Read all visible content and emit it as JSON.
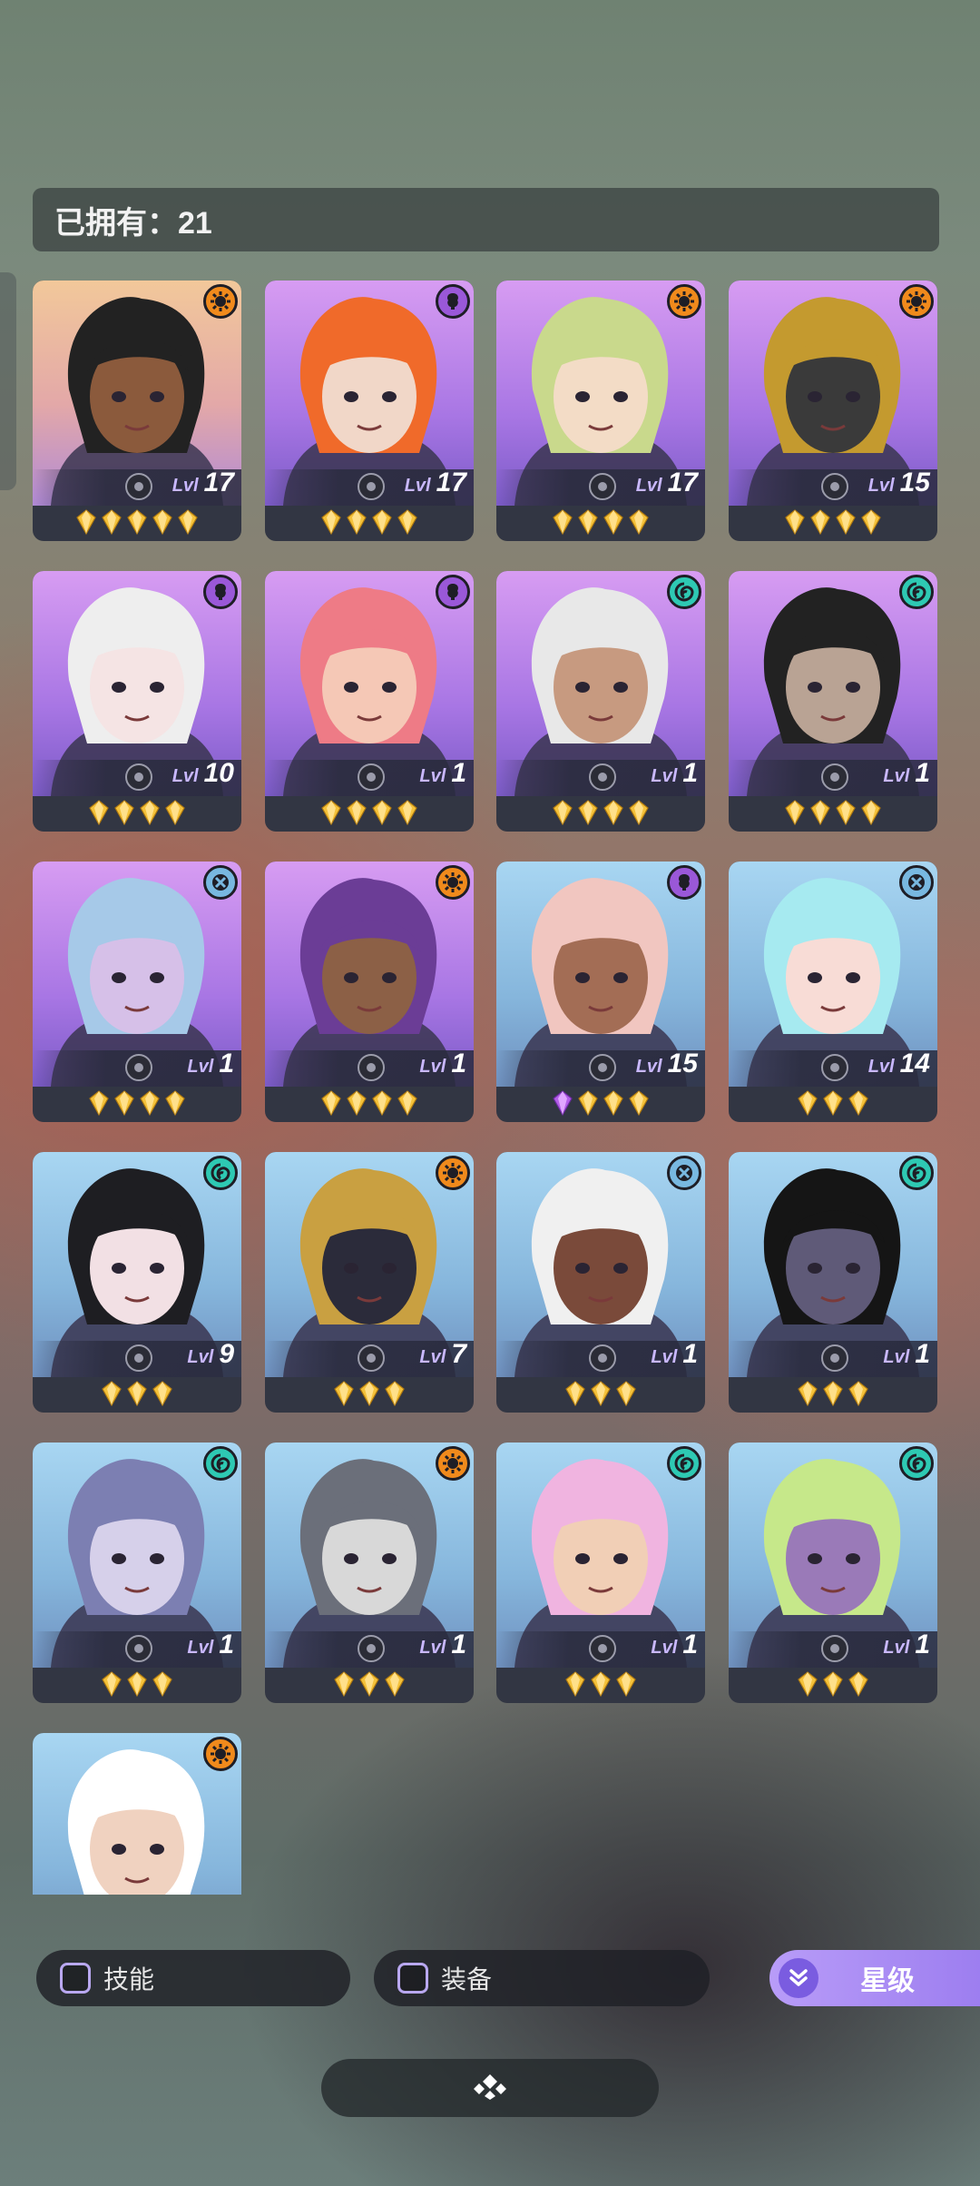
{
  "owned": {
    "label": "已拥有：21"
  },
  "level_prefix": "Lvl",
  "heroes": [
    {
      "element": "fire",
      "bg": "orange",
      "level": "17",
      "stars": 5,
      "skin": "#8b5a3c",
      "hair": "#222222"
    },
    {
      "element": "mind",
      "bg": "purple",
      "level": "17",
      "stars": 4,
      "skin": "#f1d7c8",
      "hair": "#f06a2a"
    },
    {
      "element": "fire",
      "bg": "purple",
      "level": "17",
      "stars": 4,
      "skin": "#f3dcc6",
      "hair": "#c9d98c"
    },
    {
      "element": "fire",
      "bg": "purple",
      "level": "15",
      "stars": 4,
      "skin": "#3a3a3a",
      "hair": "#c49a2f"
    },
    {
      "element": "mind",
      "bg": "purple",
      "level": "10",
      "stars": 4,
      "skin": "#f5e4e4",
      "hair": "#eeeeee"
    },
    {
      "element": "mind",
      "bg": "purple",
      "level": "1",
      "stars": 4,
      "skin": "#f5c8b6",
      "hair": "#ee7b86"
    },
    {
      "element": "wind",
      "bg": "purple",
      "level": "1",
      "stars": 4,
      "skin": "#c79a80",
      "hair": "#e8e8e8"
    },
    {
      "element": "wind",
      "bg": "purple",
      "level": "1",
      "stars": 4,
      "skin": "#b9a394",
      "hair": "#222222"
    },
    {
      "element": "cross",
      "bg": "purple",
      "level": "1",
      "stars": 4,
      "skin": "#d6c0e8",
      "hair": "#a6c9e8"
    },
    {
      "element": "fire",
      "bg": "purple",
      "level": "1",
      "stars": 4,
      "skin": "#8c6046",
      "hair": "#6b3d96"
    },
    {
      "element": "mind",
      "bg": "blue",
      "level": "15",
      "stars": 3,
      "gem": true,
      "skin": "#a36d55",
      "hair": "#f1c6c0"
    },
    {
      "element": "cross",
      "bg": "blue",
      "level": "14",
      "stars": 3,
      "skin": "#f8dcd6",
      "hair": "#a6eaf0"
    },
    {
      "element": "wind",
      "bg": "blue",
      "level": "9",
      "stars": 3,
      "skin": "#f2e0e4",
      "hair": "#1e1e22"
    },
    {
      "element": "fire",
      "bg": "blue",
      "level": "7",
      "stars": 3,
      "skin": "#2b2b3a",
      "hair": "#c9a041"
    },
    {
      "element": "cross",
      "bg": "blue",
      "level": "1",
      "stars": 3,
      "skin": "#7a4a3a",
      "hair": "#f0f0f0"
    },
    {
      "element": "wind",
      "bg": "blue",
      "level": "1",
      "stars": 3,
      "skin": "#5f5a78",
      "hair": "#151515"
    },
    {
      "element": "wind",
      "bg": "blue",
      "level": "1",
      "stars": 3,
      "skin": "#d6d0ea",
      "hair": "#7c7fb2"
    },
    {
      "element": "fire",
      "bg": "blue",
      "level": "1",
      "stars": 3,
      "skin": "#d8d8d8",
      "hair": "#6b6f7a"
    },
    {
      "element": "wind",
      "bg": "blue",
      "level": "1",
      "stars": 3,
      "skin": "#f1cfb6",
      "hair": "#f0b4e0"
    },
    {
      "element": "wind",
      "bg": "blue",
      "level": "1",
      "stars": 3,
      "skin": "#9a7ab8",
      "hair": "#c6e88a"
    },
    {
      "element": "fire",
      "bg": "blue",
      "level": "",
      "stars": 0,
      "partial": true,
      "skin": "#f0d2c0",
      "hair": "#ffffff"
    }
  ],
  "filters": {
    "skill": "技能",
    "equipment": "装备",
    "star_sort": "星级"
  },
  "icons": {
    "elements": {
      "fire": "fire-element-icon",
      "mind": "mind-element-icon",
      "wind": "wind-element-icon",
      "cross": "cross-element-icon"
    },
    "star": "gold-star-gem-icon",
    "collapse": "expand-chevron-icon"
  }
}
